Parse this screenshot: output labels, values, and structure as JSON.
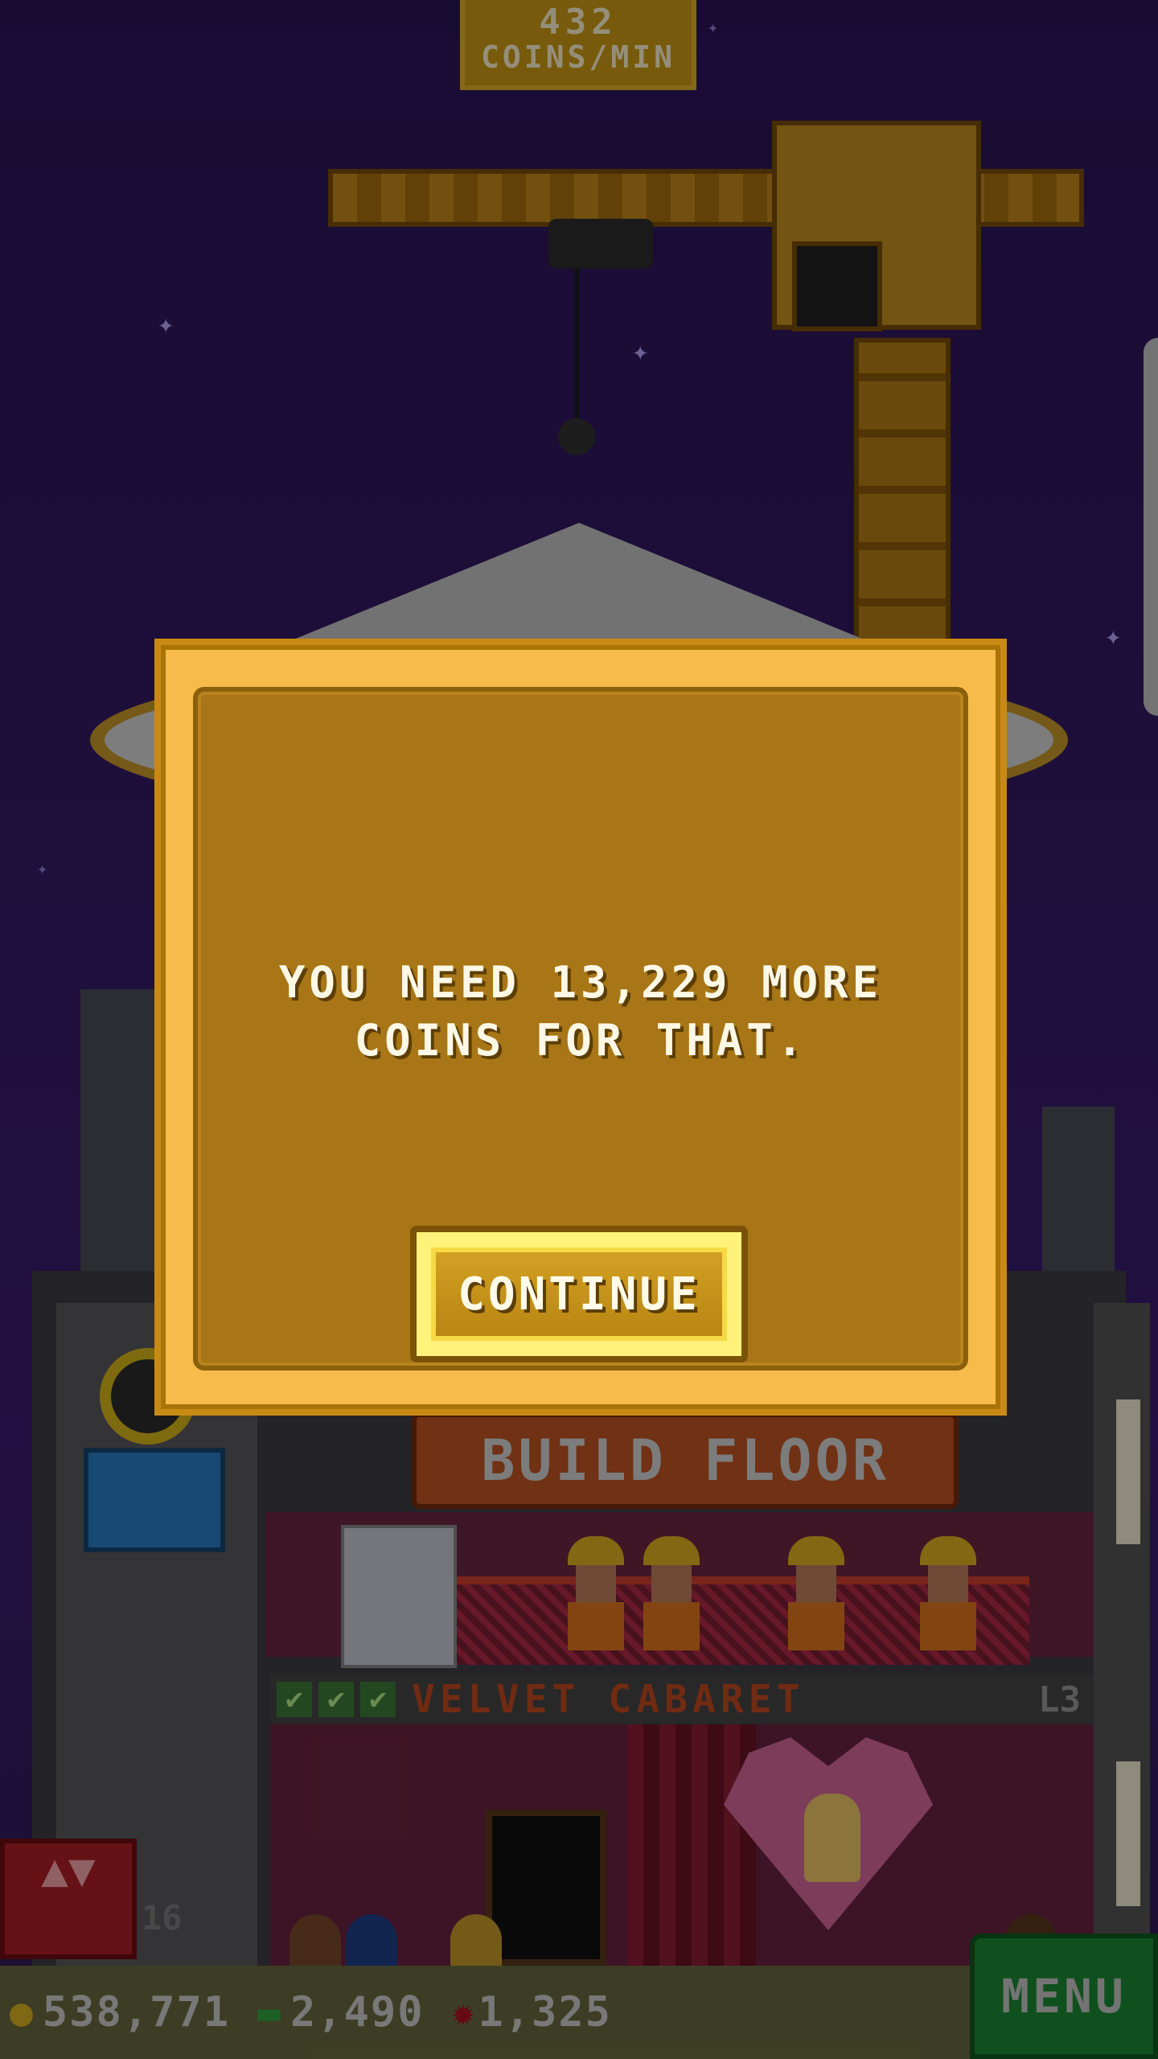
{
  "hud": {
    "rate_value": "432",
    "rate_unit": "COINS/MIN"
  },
  "construction": {
    "build_floor_label": "BUILD FLOOR"
  },
  "floor": {
    "checks": [
      "✔",
      "✔",
      "✔"
    ],
    "name": "VELVET CABARET",
    "level": "L3"
  },
  "elevator": {
    "control_glyph": "▲▼",
    "floor_number": "16"
  },
  "resources": {
    "coins": "538,771",
    "bux": "2,490",
    "tokens": "1,325"
  },
  "icons": {
    "coins": "coin-icon",
    "bux": "bux-icon",
    "tokens": "token-icon"
  },
  "menu": {
    "label": "MENU"
  },
  "dialog": {
    "message_line1": "YOU NEED 13,229 MORE",
    "message_line2": "COINS FOR THAT.",
    "continue_label": "CONTINUE"
  },
  "colors": {
    "dialog_frame": "#f7bb4c",
    "dialog_body": "#a87616",
    "menu_button": "#1d8a34",
    "build_floor_button": "#c25523"
  }
}
